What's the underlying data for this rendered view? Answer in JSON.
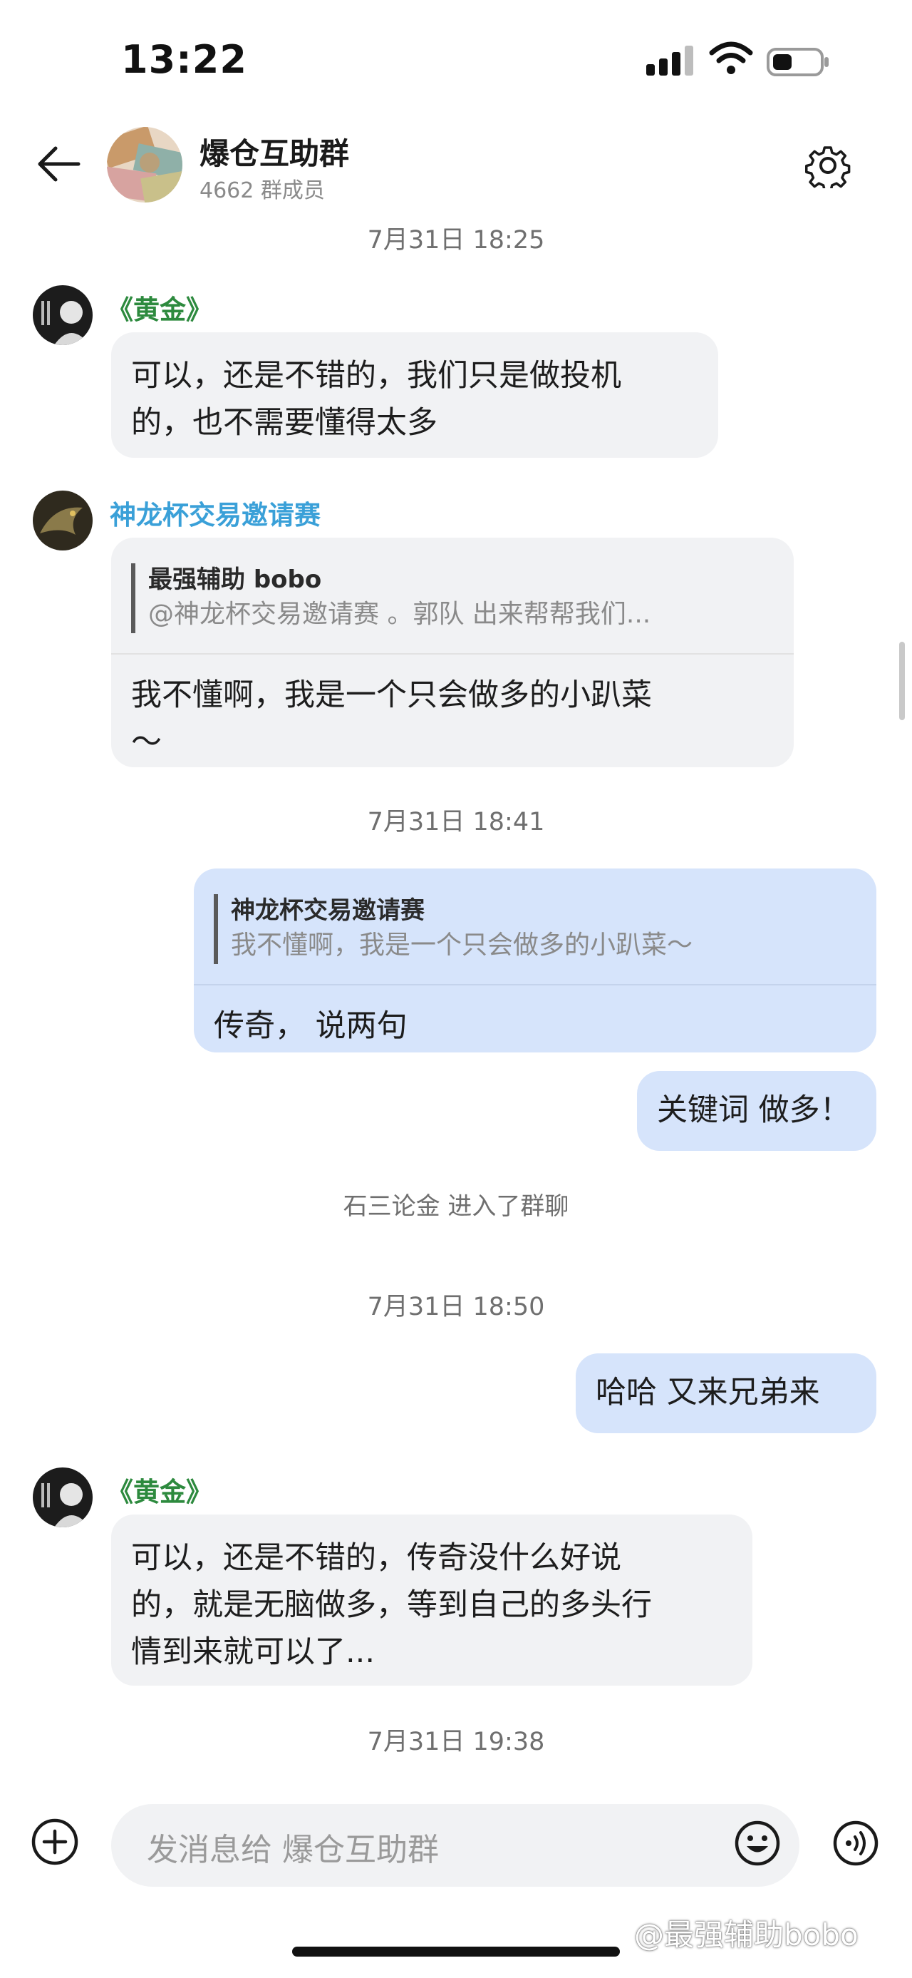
{
  "status_bar": {
    "time": "13:22"
  },
  "header": {
    "title": "爆仓互助群",
    "subtitle": "4662 群成员"
  },
  "messages": {
    "ts1": "7月31日 18:25",
    "m1": {
      "sender": "《黄金》",
      "line1": "可以，还是不错的，我们只是做投机",
      "line2": "的，也不需要懂得太多"
    },
    "m2": {
      "sender": "神龙杯交易邀请赛",
      "quote_author": "最强辅助 bobo",
      "quote_text": "@神龙杯交易邀请赛 。郭队 出来帮帮我们...",
      "line1": "我不懂啊，我是一个只会做多的小趴菜",
      "line2": "～"
    },
    "ts2": "7月31日 18:41",
    "m3": {
      "quote_author": "神龙杯交易邀请赛",
      "quote_text": "我不懂啊，我是一个只会做多的小趴菜～",
      "text": "传奇， 说两句"
    },
    "m4": {
      "text": "关键词 做多！"
    },
    "system": "石三论金 进入了群聊",
    "ts3": "7月31日 18:50",
    "m5": {
      "text": "哈哈 又来兄弟来"
    },
    "m6": {
      "sender": "《黄金》",
      "line1": "可以，还是不错的，传奇没什么好说",
      "line2": "的，就是无脑做多，等到自己的多头行",
      "line3": "情到来就可以了..."
    },
    "ts4": "7月31日 19:38"
  },
  "input": {
    "placeholder": "发消息给 爆仓互助群"
  },
  "watermark": "@最强辅助bobo",
  "colors": {
    "green_name": "#2d8a3e",
    "blue_name": "#3aa0d8",
    "my_bubble": "#d6e4fb",
    "other_bubble": "#f1f2f4"
  }
}
